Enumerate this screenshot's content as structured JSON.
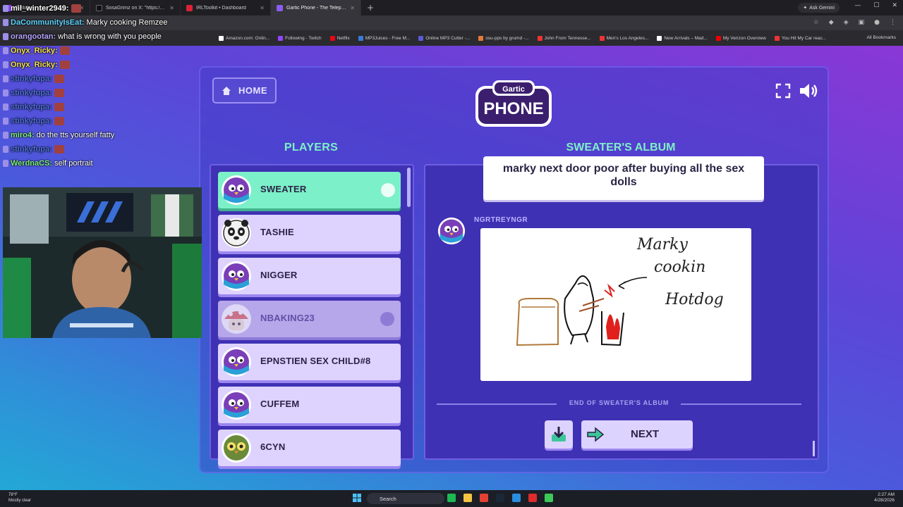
{
  "browser": {
    "tabs": [
      {
        "label": "Twitch",
        "active": false
      },
      {
        "label": "SosaGrimz on X: \"https://t.co/f",
        "active": false
      },
      {
        "label": "IRLToolkit • Dashboard",
        "active": false
      },
      {
        "label": "Gartic Phone - The Telephone G",
        "active": true
      }
    ],
    "ask_gemini": "Ask Gemini",
    "bookmarks": [
      "Amazon.com: Onlin...",
      "Following - Twitch",
      "Netflix",
      "MP3Juices - Free M...",
      "Online MP3 Cutter -...",
      "osu-pps by grumd -...",
      "John From Tennesse...",
      "Men's Los Angeles...",
      "New Arrivals – Mad...",
      "My Verizon Overview",
      "You Hit My Car reac..."
    ],
    "all_bookmarks": "All Bookmarks"
  },
  "chat": [
    {
      "user": "mil_winter2949:",
      "msg": "",
      "color": "#ffffff",
      "emote": true
    },
    {
      "user": "DaCommunityIsEat:",
      "msg": "Marky cooking Remzee",
      "color": "#5fd4ff",
      "emote": false
    },
    {
      "user": "orangootan:",
      "msg": "what is wrong with you people",
      "color": "#b8a5ff",
      "emote": false
    },
    {
      "user": "Onyx_Ricky:",
      "msg": "",
      "color": "#f2e04a",
      "emote": true
    },
    {
      "user": "Onyx_Ricky:",
      "msg": "",
      "color": "#f2e04a",
      "emote": true
    },
    {
      "user": "stinkyfupa:",
      "msg": "",
      "color": "#4c6fd8",
      "emote": true
    },
    {
      "user": "stinkyfupa:",
      "msg": "",
      "color": "#4c6fd8",
      "emote": true
    },
    {
      "user": "stinkyfupa:",
      "msg": "",
      "color": "#4c6fd8",
      "emote": true
    },
    {
      "user": "stinkyfupa:",
      "msg": "",
      "color": "#4c6fd8",
      "emote": true
    },
    {
      "user": "miro4:",
      "msg": "do the tts yourself fatty",
      "color": "#7df07a",
      "emote": false
    },
    {
      "user": "stinkyfupa:",
      "msg": "",
      "color": "#4c6fd8",
      "emote": true
    },
    {
      "user": "WerdnaCS:",
      "msg": "self portrait",
      "color": "#7df07a",
      "emote": false
    }
  ],
  "game": {
    "home_label": "HOME",
    "logo_top": "Gartic",
    "logo_bottom": "PHONE",
    "players_heading": "PLAYERS",
    "album_heading": "SWEATER'S ALBUM",
    "players": [
      {
        "name": "SWEATER",
        "state": "me"
      },
      {
        "name": "TASHIE",
        "state": "normal"
      },
      {
        "name": "NIGGER",
        "state": "normal"
      },
      {
        "name": "NBAKING23",
        "state": "gone"
      },
      {
        "name": "EPNSTIEN SEX CHILD#8",
        "state": "normal"
      },
      {
        "name": "CUFFEM",
        "state": "normal"
      },
      {
        "name": "6CYN",
        "state": "normal"
      }
    ],
    "album": {
      "prompt_text": "marky next door poor after buying all the sex dolls",
      "author": "NGRTREYNGR",
      "drawing_words": [
        "Marky",
        "cookin",
        "Hotdog"
      ],
      "end_text": "END OF SWEATER'S ALBUM",
      "next_label": "NEXT"
    }
  },
  "taskbar": {
    "weather_temp": "78°F",
    "weather_desc": "Mostly clear",
    "search": "Search",
    "time": "2:27 AM",
    "date": "4/28/2026"
  },
  "colors": {
    "accent_green": "#7df0c5",
    "panel": "#3f31b3",
    "card": "#ded2ff"
  }
}
